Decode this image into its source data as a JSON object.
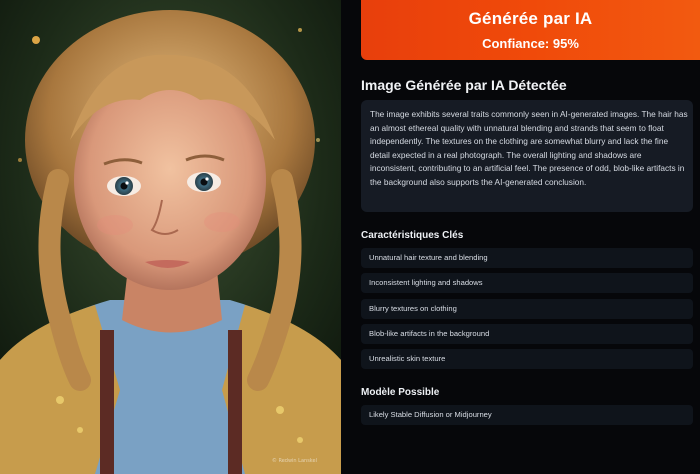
{
  "verdict": {
    "title": "Générée par IA",
    "confidence": "Confiance: 95%"
  },
  "analysis": {
    "title": "Image Générée par IA Détectée",
    "description": "The image exhibits several traits commonly seen in AI-generated images. The hair has an almost ethereal quality with unnatural blending and strands that seem to float independently. The textures on the clothing are somewhat blurry and lack the fine detail expected in a real photograph. The overall lighting and shadows are inconsistent, contributing to an artificial feel. The presence of odd, blob-like artifacts in the background also supports the AI-generated conclusion."
  },
  "features": {
    "title": "Caractéristiques Clés",
    "items": [
      "Unnatural hair texture and blending",
      "Inconsistent lighting and shadows",
      "Blurry textures on clothing",
      "Blob-like artifacts in the background",
      "Unrealistic skin texture"
    ]
  },
  "model": {
    "title": "Modèle Possible",
    "value": "Likely Stable Diffusion or Midjourney"
  },
  "image": {
    "subject": "portrait of a young girl with curly braided hair",
    "watermark": "© Redwin Lanskel"
  },
  "colors": {
    "accent": "#ef470c",
    "panel_bg": "#06070a",
    "card_bg": "#161b24",
    "item_bg": "#0f141b"
  }
}
